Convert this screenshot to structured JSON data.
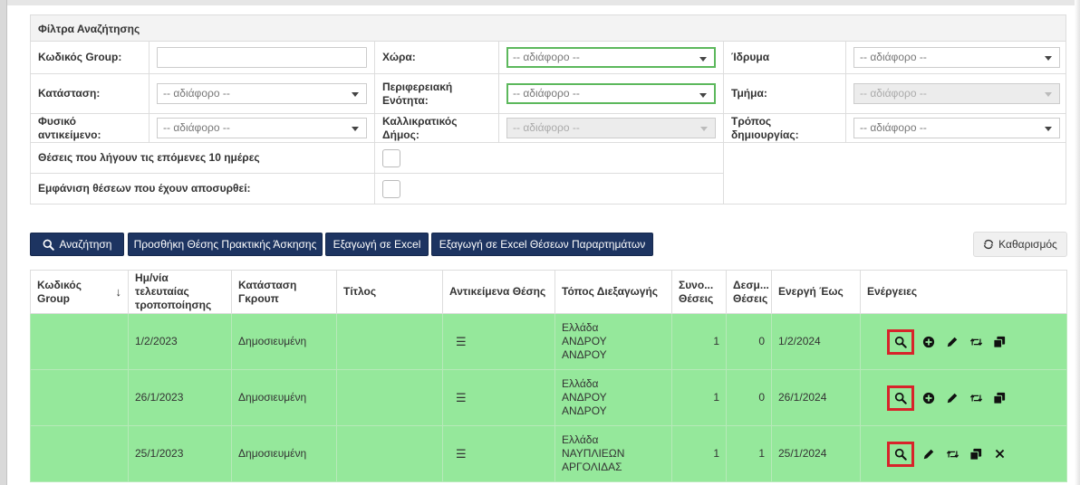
{
  "filters": {
    "title": "Φίλτρα Αναζήτησης",
    "group_code_label": "Κωδικός Group:",
    "group_code_value": "",
    "country_label": "Χώρα:",
    "country_value": "-- αδιάφορο --",
    "institution_label": "Ίδρυμα",
    "institution_value": "-- αδιάφορο --",
    "status_label": "Κατάσταση:",
    "status_value": "-- αδιάφορο --",
    "region_label": "Περιφερειακή Ενότητα:",
    "region_value": "-- αδιάφορο --",
    "department_label": "Τμήμα:",
    "department_value": "-- αδιάφορο --",
    "physical_object_label": "Φυσικό αντικείμενο:",
    "physical_object_value": "-- αδιάφορο --",
    "municipality_label": "Καλλικρατικός Δήμος:",
    "municipality_value": "-- αδιάφορο --",
    "creation_method_label": "Τρόπος δημιουργίας:",
    "creation_method_value": "-- αδιάφορο --",
    "expiring_label": "Θέσεις που λήγουν τις επόμενες 10 ημέρες",
    "withdrawn_label": "Εμφάνιση θέσεων που έχουν αποσυρθεί:"
  },
  "toolbar": {
    "search": "Αναζήτηση",
    "add_position": "Προσθήκη Θέσης Πρακτικής Άσκησης",
    "export_excel": "Εξαγωγή σε Excel",
    "export_excel_branches": "Εξαγωγή σε Excel Θέσεων Παραρτημάτων",
    "clear": "Καθαρισμός"
  },
  "table": {
    "headers": {
      "group_code": "Κωδικός Group",
      "last_modified": "Ημ/νία τελευταίας τροποποίησης",
      "group_status": "Κατάσταση Γκρουπ",
      "title": "Τίτλος",
      "objects": "Αντικείμενα Θέσης",
      "location": "Τόπος Διεξαγωγής",
      "total": "Συνο... Θέσεις",
      "committed": "Δεσμ... Θέσεις",
      "active_until": "Ενεργή Έως",
      "actions": "Ενέργειες"
    },
    "rows": [
      {
        "group_code": "",
        "last_modified": "1/2/2023",
        "status": "Δημοσιευμένη",
        "title": "",
        "loc1": "Ελλάδα",
        "loc2": "ΑΝΔΡΟΥ",
        "loc3": "ΑΝΔΡΟΥ",
        "total": "1",
        "committed": "0",
        "active_until": "1/2/2024"
      },
      {
        "group_code": "",
        "last_modified": "26/1/2023",
        "status": "Δημοσιευμένη",
        "title": "",
        "loc1": "Ελλάδα",
        "loc2": "ΑΝΔΡΟΥ",
        "loc3": "ΑΝΔΡΟΥ",
        "total": "1",
        "committed": "0",
        "active_until": "26/1/2024"
      },
      {
        "group_code": "",
        "last_modified": "25/1/2023",
        "status": "Δημοσιευμένη",
        "title": "",
        "loc1": "Ελλάδα",
        "loc2": "ΝΑΥΠΛΙΕΩΝ",
        "loc3": "ΑΡΓΟΛΙΔΑΣ",
        "total": "1",
        "committed": "1",
        "active_until": "25/1/2024"
      }
    ]
  },
  "icons": {
    "search": "search-icon",
    "add": "plus-circle-icon",
    "edit": "pencil-icon",
    "transfer": "retweet-icon",
    "copy": "copy-icon",
    "delete": "close-icon",
    "list": "list-icon",
    "sort": "sort-arrow-icon",
    "clear": "refresh-icon"
  },
  "colors": {
    "primary": "#1d3461",
    "row_green": "#95e89b",
    "highlight": "#d8232a",
    "focus_green": "#5cb85c"
  }
}
